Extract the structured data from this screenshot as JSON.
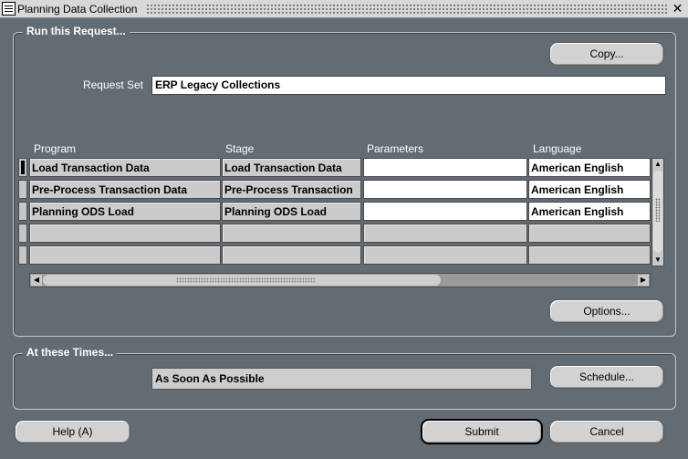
{
  "window": {
    "title": "Planning Data Collection",
    "close_glyph": "✕"
  },
  "run_group": {
    "label": "Run this Request...",
    "copy_button": "Copy...",
    "request_set_label": "Request Set",
    "request_set_value": "ERP Legacy Collections",
    "options_button": "Options..."
  },
  "table": {
    "columns": [
      "Program",
      "Stage",
      "Parameters",
      "Language"
    ],
    "rows": [
      {
        "program": "Load Transaction Data",
        "stage": "Load Transaction Data",
        "parameters": "",
        "language": "American English"
      },
      {
        "program": "Pre-Process Transaction Data",
        "stage": "Pre-Process Transaction",
        "parameters": "",
        "language": "American English"
      },
      {
        "program": "Planning ODS Load",
        "stage": "Planning ODS Load",
        "parameters": "",
        "language": "American English"
      },
      {
        "program": "",
        "stage": "",
        "parameters": "",
        "language": ""
      },
      {
        "program": "",
        "stage": "",
        "parameters": "",
        "language": ""
      }
    ]
  },
  "times_group": {
    "label": "At these Times...",
    "schedule_value": "As Soon As Possible",
    "schedule_button": "Schedule..."
  },
  "footer": {
    "help_button": "Help (A)",
    "submit_button": "Submit",
    "cancel_button": "Cancel"
  },
  "colors": {
    "background": "#636b73",
    "button": "#d2d2d2",
    "field_readonly": "#cbcbcb"
  }
}
